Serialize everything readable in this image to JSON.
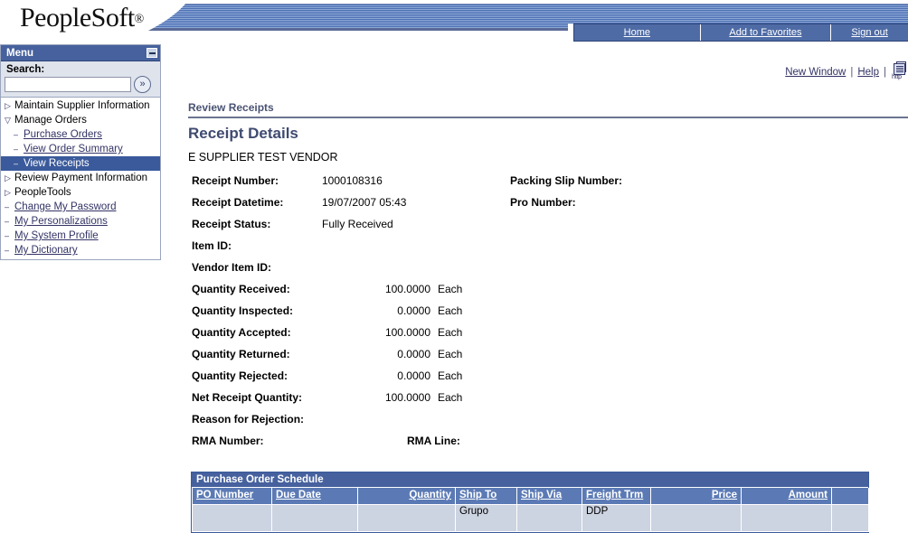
{
  "banner": {
    "logo_text": "PeopleSoft",
    "logo_reg": "®"
  },
  "nav": {
    "home": "Home",
    "add_to_favorites": "Add to Favorites",
    "sign_out": "Sign out"
  },
  "utility": {
    "new_window": "New Window",
    "help": "Help",
    "sep": "|",
    "http_label": "http"
  },
  "menu": {
    "title": "Menu",
    "search_label": "Search:",
    "search_value": "",
    "search_placeholder": "",
    "go_icon": "»",
    "items": [
      {
        "marker": "▷",
        "label": "Maintain Supplier Information",
        "type": "plain",
        "sub": false,
        "selected": false
      },
      {
        "marker": "▽",
        "label": "Manage Orders",
        "type": "plain",
        "sub": false,
        "selected": false
      },
      {
        "marker": "–",
        "label": "Purchase Orders",
        "type": "link",
        "sub": true,
        "selected": false
      },
      {
        "marker": "–",
        "label": "View Order Summary",
        "type": "link",
        "sub": true,
        "selected": false
      },
      {
        "marker": "–",
        "label": "View Receipts",
        "type": "link",
        "sub": true,
        "selected": true
      },
      {
        "marker": "▷",
        "label": "Review Payment Information",
        "type": "plain",
        "sub": false,
        "selected": false
      },
      {
        "marker": "▷",
        "label": "PeopleTools",
        "type": "plain",
        "sub": false,
        "selected": false
      },
      {
        "marker": "–",
        "label": "Change My Password",
        "type": "link",
        "sub": false,
        "selected": false
      },
      {
        "marker": "–",
        "label": "My Personalizations",
        "type": "link",
        "sub": false,
        "selected": false
      },
      {
        "marker": "–",
        "label": "My System Profile",
        "type": "link",
        "sub": false,
        "selected": false
      },
      {
        "marker": "–",
        "label": "My Dictionary",
        "type": "link",
        "sub": false,
        "selected": false
      }
    ]
  },
  "main": {
    "breadcrumb": "Review Receipts",
    "page_title": "Receipt Details",
    "vendor_name": "E SUPPLIER TEST VENDOR",
    "fields": {
      "receipt_number_label": "Receipt Number:",
      "receipt_number_value": "1000108316",
      "receipt_datetime_label": "Receipt Datetime:",
      "receipt_datetime_value": "19/07/2007 05:43",
      "receipt_status_label": "Receipt Status:",
      "receipt_status_value": "Fully Received",
      "item_id_label": "Item ID:",
      "item_id_value": "",
      "vendor_item_id_label": "Vendor Item ID:",
      "vendor_item_id_value": "",
      "packing_slip_label": "Packing Slip Number:",
      "packing_slip_value": "",
      "pro_number_label": "Pro Number:",
      "pro_number_value": "",
      "qty_received_label": "Quantity Received:",
      "qty_received_value": "100.0000",
      "qty_received_uom": "Each",
      "qty_inspected_label": "Quantity Inspected:",
      "qty_inspected_value": "0.0000",
      "qty_inspected_uom": "Each",
      "qty_accepted_label": "Quantity Accepted:",
      "qty_accepted_value": "100.0000",
      "qty_accepted_uom": "Each",
      "qty_returned_label": "Quantity Returned:",
      "qty_returned_value": "0.0000",
      "qty_returned_uom": "Each",
      "qty_rejected_label": "Quantity Rejected:",
      "qty_rejected_value": "0.0000",
      "qty_rejected_uom": "Each",
      "net_receipt_label": "Net Receipt Quantity:",
      "net_receipt_value": "100.0000",
      "net_receipt_uom": "Each",
      "reason_rejection_label": "Reason for Rejection:",
      "reason_rejection_value": "",
      "rma_number_label": "RMA Number:",
      "rma_number_value": "",
      "rma_line_label": "RMA Line:",
      "rma_line_value": ""
    }
  },
  "grid": {
    "title": "Purchase Order Schedule",
    "columns": [
      {
        "label": "PO Number",
        "align": "l"
      },
      {
        "label": "Due Date",
        "align": "l"
      },
      {
        "label": "Quantity",
        "align": "r"
      },
      {
        "label": "Ship To",
        "align": "l"
      },
      {
        "label": "Ship Via",
        "align": "l"
      },
      {
        "label": "Freight Trm",
        "align": "l"
      },
      {
        "label": "Price",
        "align": "r"
      },
      {
        "label": "Amount",
        "align": "r"
      },
      {
        "label": "",
        "align": "l"
      }
    ],
    "rows": [
      {
        "po_number": "",
        "due_date": "",
        "quantity": "",
        "ship_to": "Grupo",
        "ship_via": "",
        "freight_trm": "DDP",
        "price": "",
        "amount": "",
        "extra": ""
      }
    ]
  }
}
